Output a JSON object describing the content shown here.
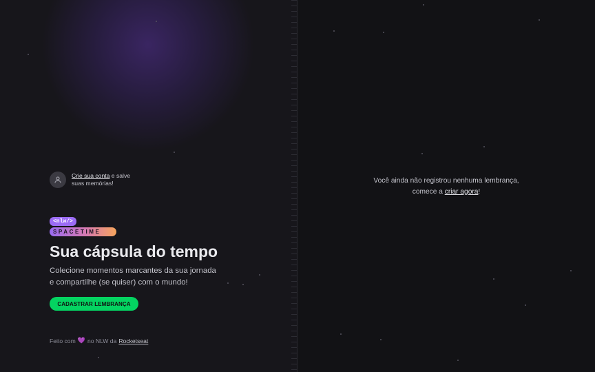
{
  "signin": {
    "link_text": "Crie sua conta",
    "text_after": " e salve suas memórias!",
    "avatar_icon": "user-icon"
  },
  "logo": {
    "badge": "<nlw/>",
    "wordmark": "SPACETIME"
  },
  "hero": {
    "title": "Sua cápsula do tempo",
    "description": "Colecione momentos marcantes da sua jornada e compartilhe (se quiser) com o mundo!",
    "cta_label": "CADASTRAR LEMBRANÇA"
  },
  "footer": {
    "prefix": "Feito com",
    "middle": "no NLW da",
    "link": "Rocketseat",
    "heart_icon": "heart-icon"
  },
  "empty_state": {
    "line1": "Você ainda não registrou nenhuma lembrança,",
    "line2_prefix": "comece a ",
    "link": "criar agora",
    "line2_suffix": "!"
  },
  "colors": {
    "accent_green": "#04d361",
    "accent_purple": "#9b6cf5",
    "background": "#121215"
  }
}
